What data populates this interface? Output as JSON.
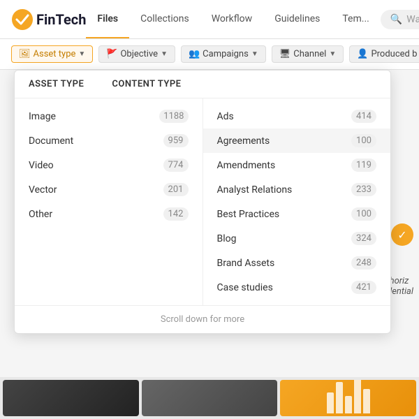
{
  "header": {
    "logo_text": "FinTech",
    "search_placeholder": "Want to search"
  },
  "nav": {
    "tabs": [
      {
        "id": "files",
        "label": "Files",
        "active": true
      },
      {
        "id": "collections",
        "label": "Collections",
        "active": false
      },
      {
        "id": "workflow",
        "label": "Workflow",
        "active": false
      },
      {
        "id": "guidelines",
        "label": "Guidelines",
        "active": false
      },
      {
        "id": "templates",
        "label": "Tem...",
        "active": false
      }
    ]
  },
  "filters": [
    {
      "id": "asset-type",
      "label": "Asset type",
      "icon": "image",
      "has_arrow": true,
      "active": true
    },
    {
      "id": "objective",
      "label": "Objective",
      "icon": "flag",
      "has_arrow": true
    },
    {
      "id": "campaigns",
      "label": "Campaigns",
      "icon": "people",
      "has_arrow": true
    },
    {
      "id": "channel",
      "label": "Channel",
      "icon": "monitor",
      "has_arrow": true
    },
    {
      "id": "produced-by",
      "label": "Produced b",
      "icon": "person",
      "has_arrow": false
    }
  ],
  "dropdown": {
    "col1_title": "Asset type",
    "col2_title": "Content type",
    "col1_items": [
      {
        "label": "Image",
        "count": "1188"
      },
      {
        "label": "Document",
        "count": "959"
      },
      {
        "label": "Video",
        "count": "774"
      },
      {
        "label": "Vector",
        "count": "201"
      },
      {
        "label": "Other",
        "count": "142"
      }
    ],
    "col2_items": [
      {
        "label": "Ads",
        "count": "414"
      },
      {
        "label": "Agreements",
        "count": "100",
        "hovered": true
      },
      {
        "label": "Amendments",
        "count": "119"
      },
      {
        "label": "Analyst Relations",
        "count": "233"
      },
      {
        "label": "Best Practices",
        "count": "100"
      },
      {
        "label": "Blog",
        "count": "324"
      },
      {
        "label": "Brand Assets",
        "count": "248"
      },
      {
        "label": "Case studies",
        "count": "421"
      }
    ],
    "scroll_more_label": "Scroll down for more"
  },
  "side_text": {
    "line1": "go horiz",
    "line2": "nfidential"
  },
  "chart_bars": [
    30,
    45,
    25,
    50,
    35
  ]
}
